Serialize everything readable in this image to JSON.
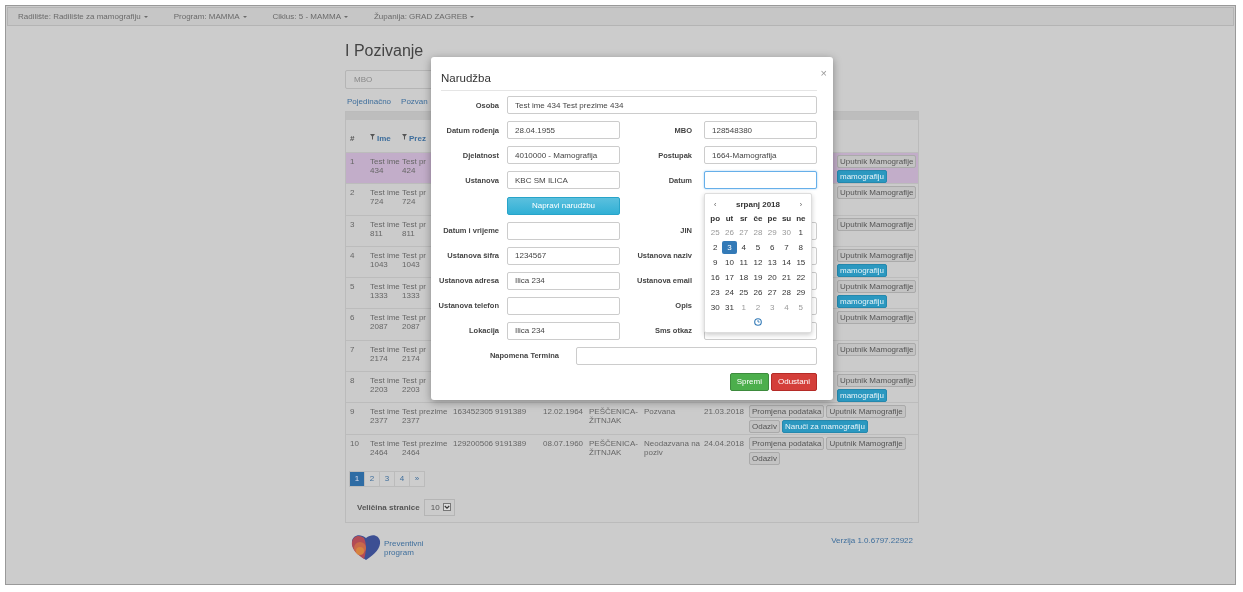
{
  "nav": [
    {
      "label": "Radilište: Radilište za mamografiju"
    },
    {
      "label": "Program: MAMMA"
    },
    {
      "label": "Ciklus: 5 - MAMMA"
    },
    {
      "label": "Županija: GRAD ZAGREB"
    }
  ],
  "page": {
    "title": "I Pozivanje",
    "search": {
      "placeholder": "MBO"
    },
    "links": [
      {
        "label": "Pojedinačno"
      },
      {
        "label": "Pozvan"
      }
    ]
  },
  "table": {
    "columns": [
      {
        "label": "#",
        "filter": false
      },
      {
        "label": "Ime",
        "filter": true
      },
      {
        "label": "Prez",
        "filter": true
      }
    ],
    "rows": [
      {
        "selected": true,
        "cells": [
          "1",
          "Test ime 434",
          "Test pr 424"
        ],
        "actions": [
          {
            "label": "Uputnik Mamografije",
            "kind": "default"
          },
          {
            "label": "mamografiju",
            "kind": "primary"
          }
        ]
      },
      {
        "selected": false,
        "cells": [
          "2",
          "Test ime 724",
          "Test pr 724"
        ],
        "actions": [
          {
            "label": "Uputnik Mamografije",
            "kind": "default"
          }
        ]
      },
      {
        "selected": false,
        "cells": [
          "3",
          "Test ime 811",
          "Test pr 811"
        ],
        "actions": [
          {
            "label": "Uputnik Mamografije",
            "kind": "default"
          }
        ]
      },
      {
        "selected": false,
        "cells": [
          "4",
          "Test ime 1043",
          "Test pr 1043"
        ],
        "actions": [
          {
            "label": "Uputnik Mamografije",
            "kind": "default"
          },
          {
            "label": "mamografiju",
            "kind": "primary"
          }
        ]
      },
      {
        "selected": false,
        "cells": [
          "5",
          "Test ime 1333",
          "Test pr 1333"
        ],
        "actions": [
          {
            "label": "Uputnik Mamografije",
            "kind": "default"
          },
          {
            "label": "mamografiju",
            "kind": "primary"
          }
        ]
      },
      {
        "selected": false,
        "cells": [
          "6",
          "Test ime 2087",
          "Test pr 2087"
        ],
        "actions": [
          {
            "label": "Uputnik Mamografije",
            "kind": "default"
          }
        ]
      },
      {
        "selected": false,
        "cells": [
          "7",
          "Test ime 2174",
          "Test pr 2174"
        ],
        "actions": [
          {
            "label": "Uputnik Mamografije",
            "kind": "default"
          }
        ]
      },
      {
        "selected": false,
        "cells": [
          "8",
          "Test ime 2203",
          "Test pr 2203"
        ],
        "actions": [
          {
            "label": "Uputnik Mamografije",
            "kind": "default"
          },
          {
            "label": "mamografiju",
            "kind": "primary"
          }
        ]
      },
      {
        "selected": false,
        "cells": [
          "9",
          "Test ime 2377",
          "Test prezime 2377",
          "163452305",
          "9191389",
          "12.02.1964",
          "PEŠČENICA-ŽITNJAK",
          "Pozvana",
          "21.03.2018"
        ],
        "actions": [
          {
            "label": "Promjena podataka",
            "kind": "default"
          },
          {
            "label": "Uputnik Mamografije",
            "kind": "default"
          },
          {
            "label": "Odaziv",
            "kind": "default"
          },
          {
            "label": "Naruči za mamografiju",
            "kind": "primary"
          }
        ]
      },
      {
        "selected": false,
        "cells": [
          "10",
          "Test ime 2464",
          "Test prezime 2464",
          "129200506",
          "9191389",
          "08.07.1960",
          "PEŠČENICA-ŽITNJAK",
          "Neodazvana na poziv",
          "24.04.2018"
        ],
        "actions": [
          {
            "label": "Promjena podataka",
            "kind": "default"
          },
          {
            "label": "Uputnik Mamografije",
            "kind": "default"
          },
          {
            "label": "Odaziv",
            "kind": "default"
          }
        ]
      }
    ]
  },
  "pagination": [
    {
      "label": "1",
      "selected": true
    },
    {
      "label": "2",
      "selected": false
    },
    {
      "label": "3",
      "selected": false
    },
    {
      "label": "4",
      "selected": false
    },
    {
      "label": "»",
      "selected": false
    }
  ],
  "page_size": {
    "label": "Veličina stranice",
    "value": "10"
  },
  "footer": {
    "logo_lines": [
      "Preventivni",
      "program"
    ],
    "version": "Verzija 1.0.6797.22922"
  },
  "modal": {
    "title": "Narudžba",
    "close": "×",
    "rows": [
      {
        "kind": "wide",
        "fields": [
          {
            "label": "Osoba",
            "value": "Test ime 434 Test prezime 434",
            "focused": false
          }
        ]
      },
      {
        "kind": "pair",
        "fields": [
          {
            "label": "Datum rođenja",
            "value": "28.04.1955",
            "focused": false
          },
          {
            "label": "MBO",
            "value": "128548380",
            "focused": false
          }
        ]
      },
      {
        "kind": "pair",
        "fields": [
          {
            "label": "Djelatnost",
            "value": "4010000 - Mamografija",
            "focused": false
          },
          {
            "label": "Postupak",
            "value": "1664-Mamografija",
            "focused": false
          }
        ]
      },
      {
        "kind": "pair",
        "fields": [
          {
            "label": "Ustanova",
            "value": "KBC SM ILICA",
            "focused": false
          },
          {
            "label": "Datum",
            "focused": true
          }
        ]
      },
      {
        "kind": "button",
        "label": "Napravi narudžbu"
      },
      {
        "kind": "pair",
        "fields": [
          {
            "label": "Datum i vrijeme",
            "focused": false
          },
          {
            "label": "JIN",
            "focused": false
          }
        ]
      },
      {
        "kind": "pair",
        "fields": [
          {
            "label": "Ustanova šifra",
            "value": "1234567",
            "focused": false
          },
          {
            "label": "Ustanova naziv",
            "focused": false
          }
        ]
      },
      {
        "kind": "pair",
        "fields": [
          {
            "label": "Ustanova adresa",
            "value": "Ilica 234",
            "focused": false
          },
          {
            "label": "Ustanova email",
            "focused": false
          }
        ]
      },
      {
        "kind": "pair",
        "fields": [
          {
            "label": "Ustanova telefon",
            "focused": false
          },
          {
            "label": "Opis",
            "focused": false
          }
        ]
      },
      {
        "kind": "pair",
        "fields": [
          {
            "label": "Lokacija",
            "value": "Ilica 234",
            "focused": false
          },
          {
            "label": "Sms otkaz",
            "focused": false
          }
        ]
      },
      {
        "kind": "note",
        "fields": [
          {
            "label": "Napomena Termina",
            "focused": false
          }
        ]
      }
    ],
    "buttons": [
      {
        "label": "Spremi",
        "kind": "success"
      },
      {
        "label": "Odustani",
        "kind": "danger"
      }
    ]
  },
  "calendar": {
    "prev": "‹",
    "month": "srpanj 2018",
    "next": "›",
    "weekdays": [
      "po",
      "ut",
      "sr",
      "če",
      "pe",
      "su",
      "ne"
    ],
    "weeks": [
      [
        {
          "day": "25",
          "muted": true,
          "selected": false
        },
        {
          "day": "26",
          "muted": true,
          "selected": false
        },
        {
          "day": "27",
          "muted": true,
          "selected": false
        },
        {
          "day": "28",
          "muted": true,
          "selected": false
        },
        {
          "day": "29",
          "muted": true,
          "selected": false
        },
        {
          "day": "30",
          "muted": true,
          "selected": false
        },
        {
          "day": "1",
          "muted": false,
          "selected": false
        }
      ],
      [
        {
          "day": "2",
          "muted": false,
          "selected": false
        },
        {
          "day": "3",
          "muted": false,
          "selected": true
        },
        {
          "day": "4",
          "muted": false,
          "selected": false
        },
        {
          "day": "5",
          "muted": false,
          "selected": false
        },
        {
          "day": "6",
          "muted": false,
          "selected": false
        },
        {
          "day": "7",
          "muted": false,
          "selected": false
        },
        {
          "day": "8",
          "muted": false,
          "selected": false
        }
      ],
      [
        {
          "day": "9",
          "muted": false,
          "selected": false
        },
        {
          "day": "10",
          "muted": false,
          "selected": false
        },
        {
          "day": "11",
          "muted": false,
          "selected": false
        },
        {
          "day": "12",
          "muted": false,
          "selected": false
        },
        {
          "day": "13",
          "muted": false,
          "selected": false
        },
        {
          "day": "14",
          "muted": false,
          "selected": false
        },
        {
          "day": "15",
          "muted": false,
          "selected": false
        }
      ],
      [
        {
          "day": "16",
          "muted": false,
          "selected": false
        },
        {
          "day": "17",
          "muted": false,
          "selected": false
        },
        {
          "day": "18",
          "muted": false,
          "selected": false
        },
        {
          "day": "19",
          "muted": false,
          "selected": false
        },
        {
          "day": "20",
          "muted": false,
          "selected": false
        },
        {
          "day": "21",
          "muted": false,
          "selected": false
        },
        {
          "day": "22",
          "muted": false,
          "selected": false
        }
      ],
      [
        {
          "day": "23",
          "muted": false,
          "selected": false
        },
        {
          "day": "24",
          "muted": false,
          "selected": false
        },
        {
          "day": "25",
          "muted": false,
          "selected": false
        },
        {
          "day": "26",
          "muted": false,
          "selected": false
        },
        {
          "day": "27",
          "muted": false,
          "selected": false
        },
        {
          "day": "28",
          "muted": false,
          "selected": false
        },
        {
          "day": "29",
          "muted": false,
          "selected": false
        }
      ],
      [
        {
          "day": "30",
          "muted": false,
          "selected": false
        },
        {
          "day": "31",
          "muted": false,
          "selected": false
        },
        {
          "day": "1",
          "muted": true,
          "selected": false
        },
        {
          "day": "2",
          "muted": true,
          "selected": false
        },
        {
          "day": "3",
          "muted": true,
          "selected": false
        },
        {
          "day": "4",
          "muted": true,
          "selected": false
        },
        {
          "day": "5",
          "muted": true,
          "selected": false
        }
      ]
    ]
  }
}
